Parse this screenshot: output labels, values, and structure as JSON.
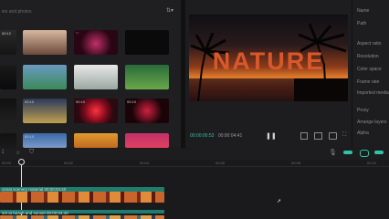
{
  "media": {
    "search_placeholder": "ies and photos",
    "filter_icon": "filter-icon",
    "thumbs": [
      {
        "label": "00:12"
      },
      {
        "label": ""
      },
      {
        "label": "♡"
      },
      {
        "label": ""
      },
      {
        "label": ""
      },
      {
        "label": ""
      },
      {
        "label": ""
      },
      {
        "label": ""
      },
      {
        "label": ""
      },
      {
        "label": "00:10"
      },
      {
        "label": "00:10"
      },
      {
        "label": "00:10"
      },
      {
        "label": ""
      },
      {
        "label": "00:10"
      },
      {
        "label": ""
      },
      {
        "label": ""
      }
    ]
  },
  "preview": {
    "title_text": "NATURE",
    "time_current": "00:00:00:53",
    "time_total": "00:00:04:41"
  },
  "properties": {
    "labels": [
      "Name",
      "Path",
      "Aspect ratio",
      "Resolution",
      "Color space",
      "Frame rate",
      "Imported media",
      "Proxy",
      "Arrange layers",
      "Alpha"
    ],
    "proxy_value": "ⓘ"
  },
  "timeline": {
    "ticks": [
      "00:00",
      "00:02",
      "00:04",
      "00:06",
      "00:08",
      "00:10"
    ],
    "clip1_label": "cenat scenery material  00:00:04:40",
    "clip2_label": "set at beach and sunset  00:00:04:40"
  },
  "colors": {
    "accent": "#2ec4a5",
    "clip_teal": "#1f7d6f",
    "clip_orange": "#c9652b"
  }
}
